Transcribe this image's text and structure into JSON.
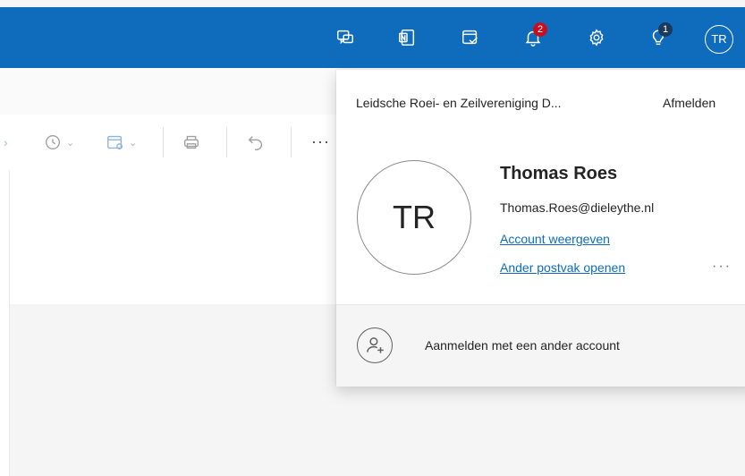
{
  "topbar": {
    "icons": [
      {
        "name": "teams-chat-icon"
      },
      {
        "name": "onenote-icon"
      },
      {
        "name": "my-day-icon"
      },
      {
        "name": "notifications-bell-icon",
        "badge": "2",
        "badge_color": "#c50f1f"
      },
      {
        "name": "settings-gear-icon"
      },
      {
        "name": "tips-lightbulb-icon",
        "badge": "1",
        "badge_color": "#1b3a5c"
      }
    ],
    "avatar_initials": "TR",
    "background_color": "#0f6cbd"
  },
  "toolbar": {
    "more_label": "···"
  },
  "account_panel": {
    "organization": "Leidsche Roei- en Zeilvereniging D...",
    "sign_out_label": "Afmelden",
    "avatar_initials": "TR",
    "user_name": "Thomas Roes",
    "email": "Thomas.Roes@dieleythe.nl",
    "view_account_link": "Account weergeven",
    "open_mailbox_link": "Ander postvak openen",
    "more_options": "···",
    "add_account_label": "Aanmelden met een ander account"
  },
  "colors": {
    "link": "#0f6cbd",
    "badge_red": "#c50f1f"
  }
}
